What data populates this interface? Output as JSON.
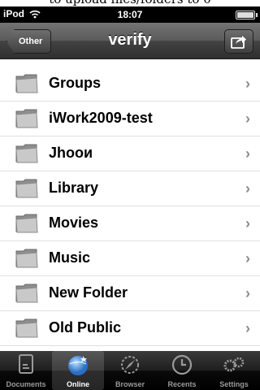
{
  "caption": "to upload files/folders to 0",
  "status": {
    "carrier": "iPod",
    "time": "18:07"
  },
  "nav": {
    "back_label": "Other",
    "title": "verify"
  },
  "folders": [
    {
      "name": "Groups"
    },
    {
      "name": "iWork2009-test"
    },
    {
      "name": "Jhooи"
    },
    {
      "name": "Library"
    },
    {
      "name": "Movies"
    },
    {
      "name": "Music"
    },
    {
      "name": "New Folder"
    },
    {
      "name": "Old Public"
    }
  ],
  "tabs": [
    {
      "label": "Documents",
      "icon": "documents-icon"
    },
    {
      "label": "Online",
      "icon": "online-globe-icon",
      "active": true
    },
    {
      "label": "Browser",
      "icon": "compass-icon"
    },
    {
      "label": "Recents",
      "icon": "clock-icon"
    },
    {
      "label": "Settings",
      "icon": "gears-icon"
    }
  ],
  "colors": {
    "nav_bar": "#4a4a4a",
    "tab_active_blue": "#4a8fd8"
  }
}
